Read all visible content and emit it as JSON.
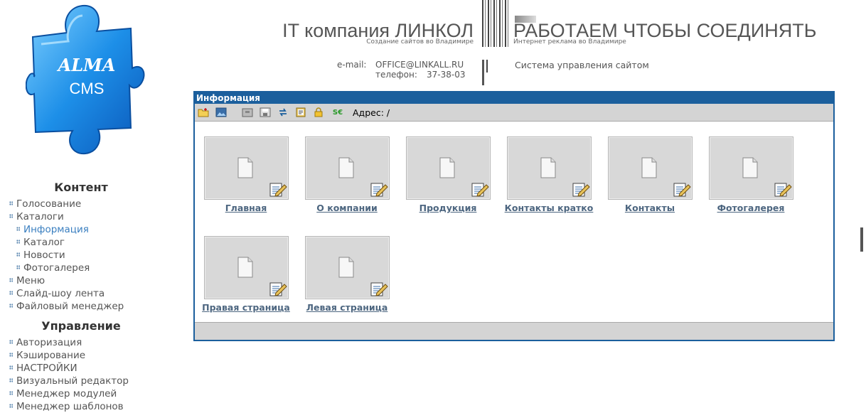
{
  "logo": {
    "line1": "ALMA",
    "line2": "CMS"
  },
  "header": {
    "company": "IT компания ЛИНКОЛ",
    "company_sub": "Создание сайтов во Владимире",
    "slogan": "РАБОТАЕМ ЧТОБЫ СОЕДИНЯТЬ",
    "slogan_sub": "Интернет реклама во Владимире",
    "email_label": "e-mail:",
    "email": "OFFICE@LINKALL.RU",
    "phone_label": "телефон:",
    "phone": "37-38-03",
    "cms_link": "Система управления сайтом"
  },
  "sidebar": {
    "content_title": "Контент",
    "content_items": [
      {
        "label": "Голосование"
      },
      {
        "label": "Каталоги"
      },
      {
        "label": "Информация"
      },
      {
        "label": "Каталог"
      },
      {
        "label": "Новости"
      },
      {
        "label": "Фотогалерея"
      },
      {
        "label": "Меню"
      },
      {
        "label": "Слайд-шоу лента"
      },
      {
        "label": "Файловый менеджер"
      }
    ],
    "admin_title": "Управление",
    "admin_items": [
      {
        "label": "Авторизация"
      },
      {
        "label": "Кэширование"
      },
      {
        "label": "НАСТРОЙКИ"
      },
      {
        "label": "Визуальный редактор"
      },
      {
        "label": "Менеджер модулей"
      },
      {
        "label": "Менеджер шаблонов"
      }
    ]
  },
  "panel": {
    "title": "Информация",
    "address_label": "Адрес:",
    "address_value": "/",
    "toolbar_icons": [
      "new-folder-icon",
      "image-icon",
      "archive-icon",
      "save-icon",
      "refresh-icon",
      "clipboard-icon",
      "lock-icon",
      "se-icon"
    ],
    "items": [
      {
        "label": "Главная"
      },
      {
        "label": "О компании"
      },
      {
        "label": "Продукция"
      },
      {
        "label": "Контакты кратко"
      },
      {
        "label": "Контакты"
      },
      {
        "label": "Фотогалерея"
      },
      {
        "label": "Правая страница"
      },
      {
        "label": "Левая страница"
      }
    ]
  },
  "colors": {
    "accent": "#1b5f9d",
    "active_link": "#3a7fc0",
    "panel_gray": "#d4d4d4"
  }
}
